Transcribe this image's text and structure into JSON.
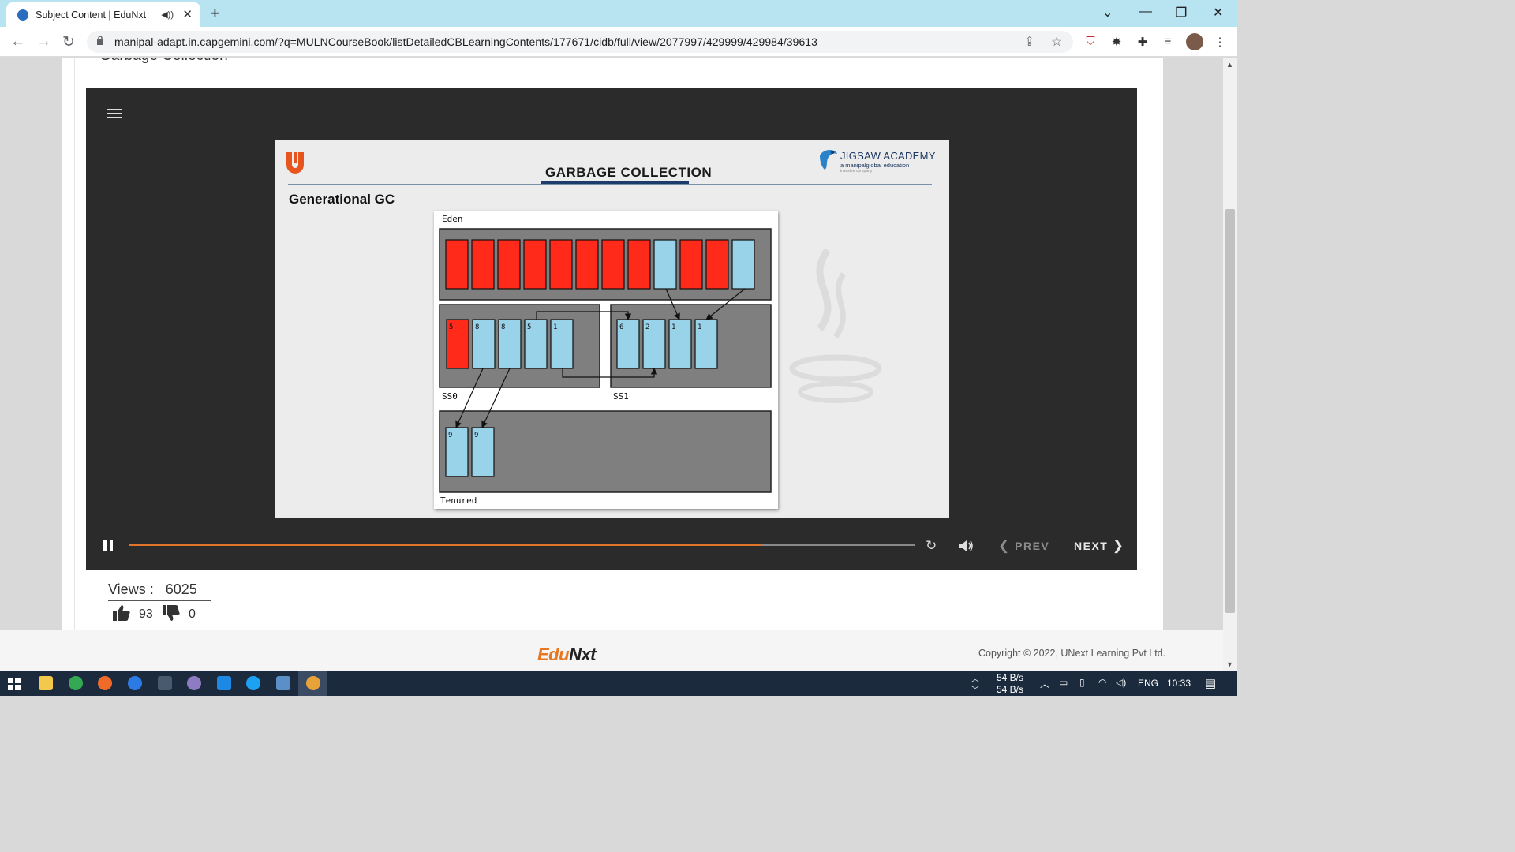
{
  "browser": {
    "tab_title": "Subject Content | EduNxt",
    "url": "manipal-adapt.in.capgemini.com/?q=MULNCourseBook/listDetailedCBLearningContents/177671/cidb/full/view/2077997/429999/429984/39613"
  },
  "page": {
    "section_title_cut": "Garbage Collection"
  },
  "slide": {
    "title": "GARBAGE COLLECTION",
    "heading": "Generational GC",
    "brand_name": "JIGSAW ACADEMY",
    "brand_sub": "a manipalglobal education",
    "brand_sub2": "investee company",
    "diagram": {
      "eden_label": "Eden",
      "ss0_label": "SS0",
      "ss1_label": "SS1",
      "tenured_label": "Tenured",
      "eden_cells": [
        "red",
        "red",
        "red",
        "red",
        "red",
        "red",
        "red",
        "red",
        "blue",
        "red",
        "red",
        "blue"
      ],
      "ss0_cells": [
        {
          "num": "5",
          "color": "red"
        },
        {
          "num": "8",
          "color": "blue"
        },
        {
          "num": "8",
          "color": "blue"
        },
        {
          "num": "5",
          "color": "blue"
        },
        {
          "num": "1",
          "color": "blue"
        }
      ],
      "ss1_cells": [
        {
          "num": "6",
          "color": "blue"
        },
        {
          "num": "2",
          "color": "blue"
        },
        {
          "num": "1",
          "color": "blue"
        },
        {
          "num": "1",
          "color": "blue"
        }
      ],
      "tenured_cells": [
        {
          "num": "9",
          "color": "blue"
        },
        {
          "num": "9",
          "color": "blue"
        }
      ],
      "colors": {
        "red": "#ff2a1a",
        "blue": "#99d3ea",
        "gray": "#7f7f7f"
      }
    }
  },
  "player": {
    "progress": 0.805,
    "prev_label": "PREV",
    "next_label": "NEXT"
  },
  "stats": {
    "views_label": "Views :",
    "views_count": "6025",
    "likes": "93",
    "dislikes": "0"
  },
  "footer": {
    "logo_edu": "Edu",
    "logo_nxt": "Nxt",
    "copyright": "Copyright © 2022, UNext Learning Pvt Ltd."
  },
  "taskbar": {
    "net_up": "54 B/s",
    "net_down": "54 B/s",
    "lang": "ENG",
    "time": "10:33"
  }
}
